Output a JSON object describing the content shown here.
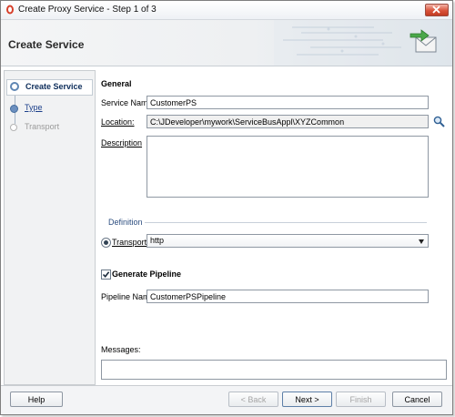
{
  "window": {
    "title": "Create Proxy Service - Step 1 of 3"
  },
  "header": {
    "title": "Create Service",
    "banner_icon": "envelope-arrow-icon"
  },
  "steps": [
    {
      "label": "Create Service",
      "state": "current"
    },
    {
      "label": "Type",
      "state": "link"
    },
    {
      "label": "Transport",
      "state": "disabled"
    }
  ],
  "general": {
    "heading": "General",
    "service_name_label": "Service Name:",
    "service_name_value": "CustomerPS",
    "location_label": "Location:",
    "location_value": "C:\\JDeveloper\\mywork\\ServiceBusAppl\\XYZCommon",
    "description_label": "Description",
    "description_value": ""
  },
  "definition": {
    "heading": "Definition",
    "transport_label": "Transport",
    "transport_value": "http"
  },
  "pipeline": {
    "generate_label": "Generate Pipeline",
    "generate_checked": true,
    "name_label": "Pipeline Name:",
    "name_value": "CustomerPSPipeline"
  },
  "messages": {
    "label": "Messages:",
    "value": ""
  },
  "buttons": {
    "help": "Help",
    "back": "< Back",
    "next": "Next >",
    "finish": "Finish",
    "cancel": "Cancel"
  },
  "colors": {
    "accent": "#5f86b3",
    "link": "#1b3f8a",
    "close": "#d9533b"
  }
}
